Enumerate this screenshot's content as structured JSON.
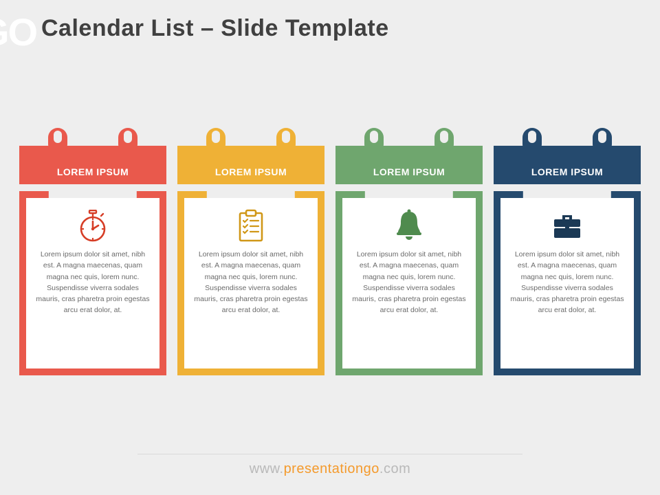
{
  "logoFragment": "GO",
  "title": "Calendar List – Slide Template",
  "footer": {
    "www": "www.",
    "name": "presentationgo",
    "tld": ".com"
  },
  "colors": {
    "red": "#e9594c",
    "redDark": "#d63d26",
    "yellow": "#efb136",
    "yellowDark": "#d09717",
    "green": "#6fa66e",
    "greenDark": "#4f8b4e",
    "navy": "#254a6e",
    "navyDark": "#1b3955"
  },
  "cards": [
    {
      "label": "LOREM IPSUM",
      "iconName": "stopwatch-icon",
      "colorKey": "red",
      "body": "Lorem ipsum dolor sit amet, nibh est. A magna maecenas, quam magna nec quis, lorem nunc. Suspendisse viverra sodales mauris, cras pharetra proin egestas arcu erat dolor, at."
    },
    {
      "label": "LOREM IPSUM",
      "iconName": "checklist-icon",
      "colorKey": "yellow",
      "body": "Lorem ipsum dolor sit amet, nibh est. A magna maecenas, quam magna nec quis, lorem nunc. Suspendisse viverra sodales mauris, cras pharetra proin egestas arcu erat dolor, at."
    },
    {
      "label": "LOREM IPSUM",
      "iconName": "bell-icon",
      "colorKey": "green",
      "body": "Lorem ipsum dolor sit amet, nibh est. A magna maecenas, quam magna nec quis, lorem nunc. Suspendisse viverra sodales mauris, cras pharetra proin egestas arcu erat dolor, at."
    },
    {
      "label": "LOREM IPSUM",
      "iconName": "briefcase-icon",
      "colorKey": "navy",
      "body": "Lorem ipsum dolor sit amet, nibh est. A magna maecenas, quam magna nec quis, lorem nunc. Suspendisse viverra sodales mauris, cras pharetra proin egestas arcu erat dolor, at."
    }
  ]
}
